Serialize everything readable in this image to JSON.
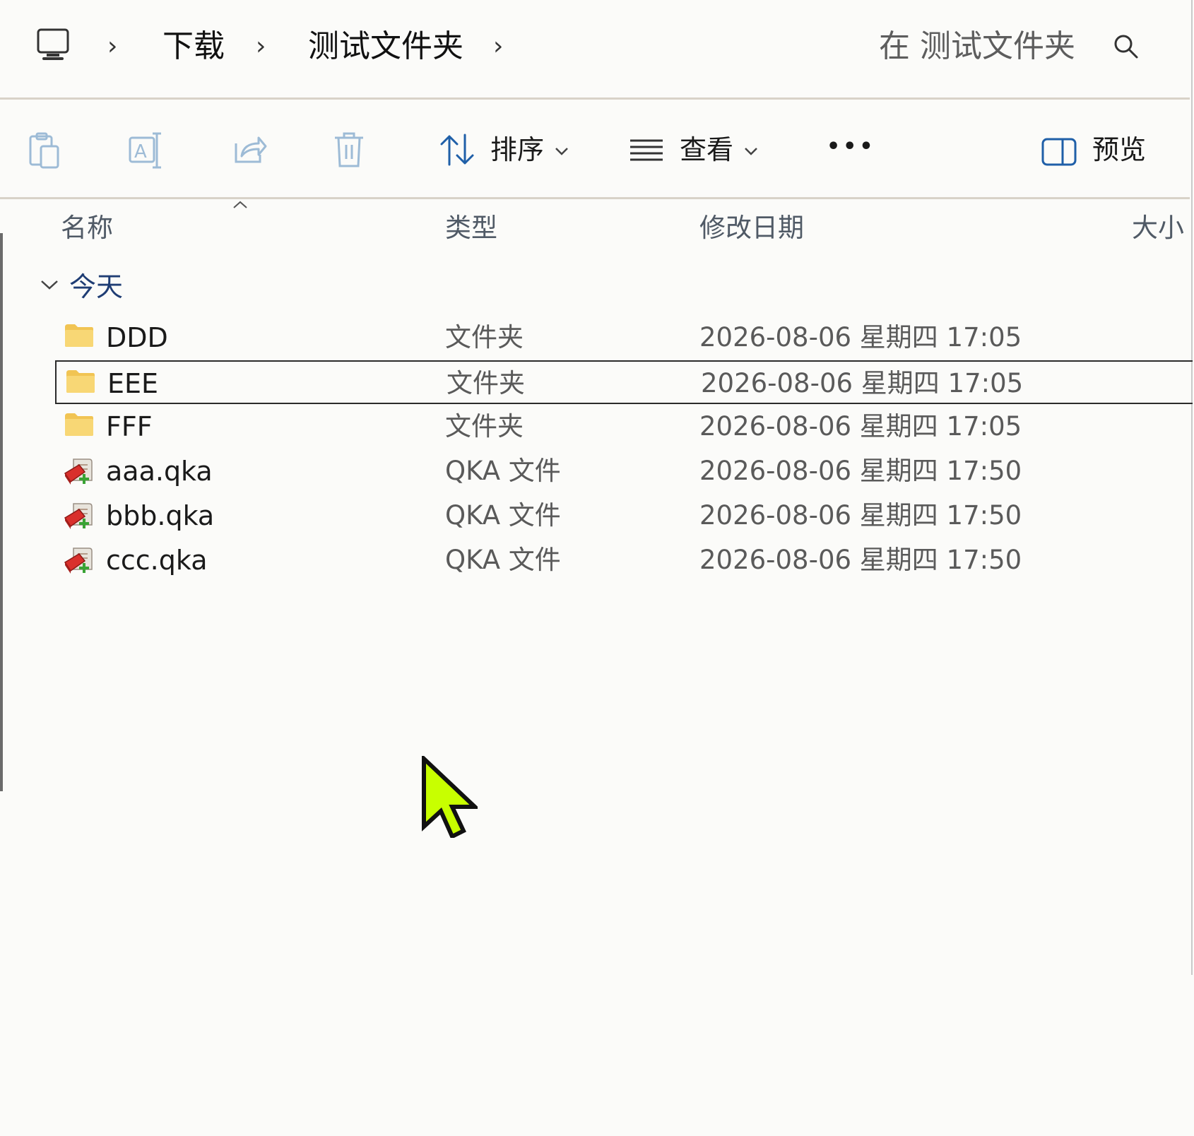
{
  "address_bar": {
    "breadcrumbs": [
      "下载",
      "测试文件夹"
    ],
    "search_placeholder": "在 测试文件夹"
  },
  "command_bar": {
    "sort_label": "排序",
    "view_label": "查看",
    "more_label": "•••",
    "preview_label": "预览"
  },
  "columns": {
    "name": "名称",
    "type": "类型",
    "modified": "修改日期",
    "size": "大小"
  },
  "group": {
    "label": "今天"
  },
  "files": [
    {
      "name": "DDD",
      "type": "文件夹",
      "modified": "2026-08-06 星期四 17:05",
      "icon": "folder-icon",
      "selected": false
    },
    {
      "name": "EEE",
      "type": "文件夹",
      "modified": "2026-08-06 星期四 17:05",
      "icon": "folder-icon",
      "selected": true
    },
    {
      "name": "FFF",
      "type": "文件夹",
      "modified": "2026-08-06 星期四 17:05",
      "icon": "folder-icon",
      "selected": false
    },
    {
      "name": "aaa.qka",
      "type": "QKA 文件",
      "modified": "2026-08-06 星期四 17:50",
      "icon": "qka-file-icon",
      "selected": false
    },
    {
      "name": "bbb.qka",
      "type": "QKA 文件",
      "modified": "2026-08-06 星期四 17:50",
      "icon": "qka-file-icon",
      "selected": false
    },
    {
      "name": "ccc.qka",
      "type": "QKA 文件",
      "modified": "2026-08-06 星期四 17:50",
      "icon": "qka-file-icon",
      "selected": false
    }
  ],
  "colors": {
    "background": "#fbfbf9",
    "folder": "#f8d775",
    "accent": "#0067c0",
    "cursor": "#c8ff00"
  }
}
